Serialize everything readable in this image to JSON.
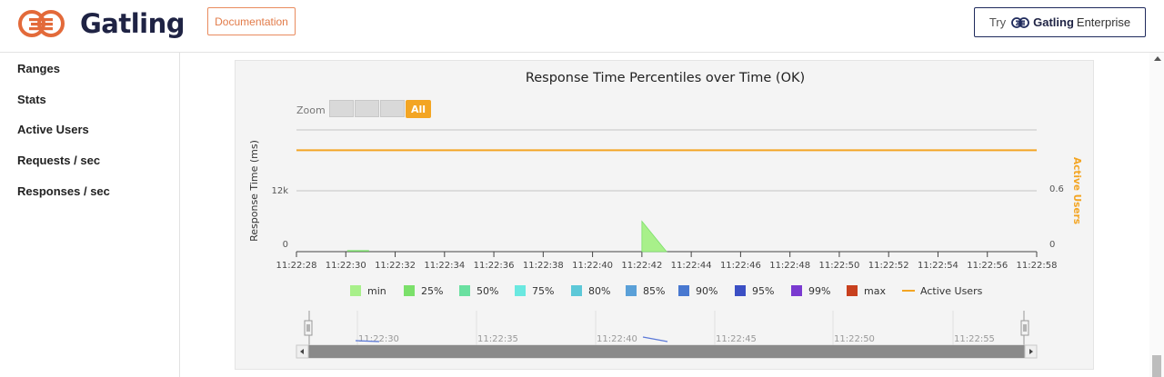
{
  "header": {
    "logo_text": "Gatling",
    "documentation_label": "Documentation",
    "enterprise_try": "Try",
    "enterprise_brand": "Gatling",
    "enterprise_suffix": "Enterprise"
  },
  "sidebar": {
    "items": [
      {
        "label": "Ranges"
      },
      {
        "label": "Stats"
      },
      {
        "label": "Active Users"
      },
      {
        "label": "Requests / sec"
      },
      {
        "label": "Responses / sec"
      }
    ]
  },
  "chart": {
    "zoom_label": "Zoom",
    "zoom_all_label": "All"
  },
  "colors": {
    "accent": "#f3a523",
    "brand": "#1f2344",
    "doc_border": "#e98b5e"
  },
  "chart_data": {
    "type": "area",
    "title": "Response Time Percentiles over Time (OK)",
    "ylabel": "Response Time (ms)",
    "y2label": "Active Users",
    "ylim": [
      0,
      24000
    ],
    "y2lim": [
      0,
      1.2
    ],
    "y_ticks": [
      "0",
      "12k"
    ],
    "y2_ticks": [
      "0",
      "0.6"
    ],
    "categories": [
      "11:22:28",
      "11:22:30",
      "11:22:32",
      "11:22:34",
      "11:22:36",
      "11:22:38",
      "11:22:40",
      "11:22:42",
      "11:22:44",
      "11:22:46",
      "11:22:48",
      "11:22:50",
      "11:22:52",
      "11:22:54",
      "11:22:56",
      "11:22:58"
    ],
    "series": [
      {
        "name": "min",
        "color": "#a8f08a"
      },
      {
        "name": "25%",
        "color": "#7be06a"
      },
      {
        "name": "50%",
        "color": "#6ae0a0"
      },
      {
        "name": "75%",
        "color": "#6ae8e0"
      },
      {
        "name": "80%",
        "color": "#5cc8d8"
      },
      {
        "name": "85%",
        "color": "#5aa0d8"
      },
      {
        "name": "90%",
        "color": "#4878d0"
      },
      {
        "name": "95%",
        "color": "#3b4fc4"
      },
      {
        "name": "99%",
        "color": "#7a3ad0"
      },
      {
        "name": "max",
        "color": "#c8401e"
      },
      {
        "name": "Active Users",
        "color": "#f3a523",
        "line": true
      }
    ],
    "active_users_value": 1,
    "percentile_points": [
      {
        "x": "11:22:30.5",
        "y": 150
      },
      {
        "x": "11:22:42",
        "y": 6000
      },
      {
        "x": "11:22:43",
        "y": 0
      }
    ],
    "navigator_ticks": [
      "11:22:30",
      "11:22:35",
      "11:22:40",
      "11:22:45",
      "11:22:50",
      "11:22:55"
    ],
    "legend_position": "bottom",
    "grid": true
  }
}
